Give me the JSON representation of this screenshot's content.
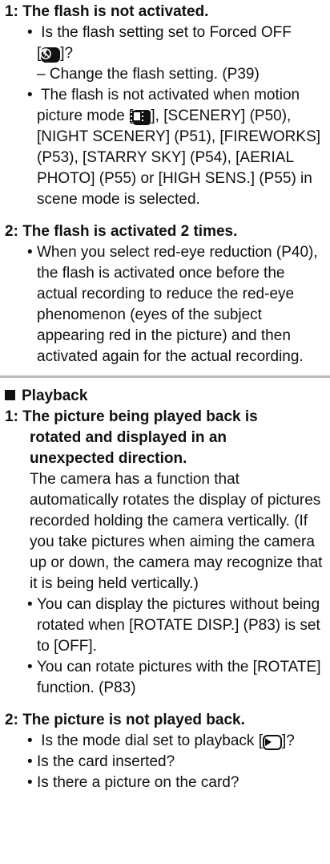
{
  "recording": {
    "q1": {
      "title": "1: The flash is not activated.",
      "b1_pre": "Is the flash setting set to Forced OFF",
      "b1_post_open": "[",
      "b1_post_close": "]?",
      "icon_flash_off": "flash-off-icon",
      "dash": "– Change the flash setting. (P39)",
      "b2_pre": "The flash is not activated when motion picture mode [",
      "icon_motion": "motion-picture-icon",
      "b2_post": "], [SCENERY] (P50), [NIGHT SCENERY] (P51), [FIREWORKS] (P53), [STARRY SKY] (P54), [AERIAL PHOTO] (P55) or [HIGH SENS.] (P55) in scene mode is selected."
    },
    "q2": {
      "title": "2: The flash is activated 2 times.",
      "b1": "When you select red-eye reduction (P40), the flash is activated once before the actual recording to reduce the red-eye phenomenon (eyes of the subject appearing red in the picture) and then activated again for the actual recording."
    }
  },
  "playback": {
    "heading": "Playback",
    "q1": {
      "title_line1": "1: The picture being played back is",
      "title_line2": "rotated and displayed in an",
      "title_line3": "unexpected direction.",
      "para": "The camera has a function that automatically rotates the display of pictures recorded holding the camera vertically. (If you take pictures when aiming the camera up or down, the camera may recognize that it is being held vertically.)",
      "b1": "You can display the pictures without being rotated when [ROTATE DISP.] (P83) is set to [OFF].",
      "b2": "You can rotate pictures with the [ROTATE] function. (P83)"
    },
    "q2": {
      "title": "2: The picture is not played back.",
      "b1_pre": "Is the mode dial set to playback [",
      "icon_play": "playback-icon",
      "b1_post": "]?",
      "b2": "Is the card inserted?",
      "b3": "Is there a picture on the card?"
    }
  }
}
